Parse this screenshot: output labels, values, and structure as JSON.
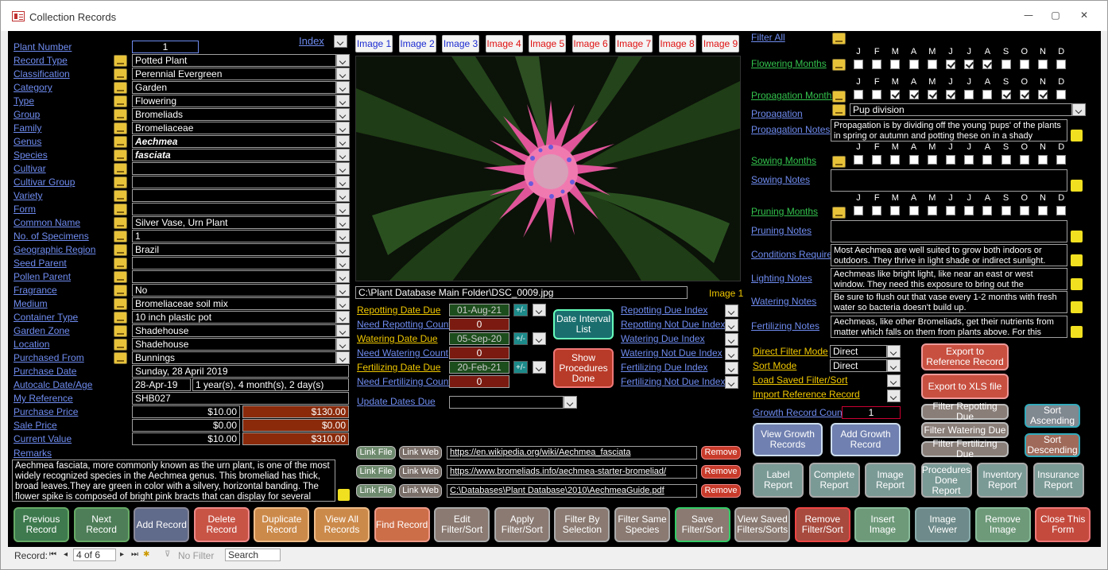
{
  "window": {
    "title": "Collection Records",
    "min": "—",
    "max": "▢",
    "close": "✕"
  },
  "left": {
    "index_label": "Index",
    "rows": [
      {
        "label": "Plant Number",
        "value": "1"
      },
      {
        "label": "Record Type",
        "value": "Potted Plant"
      },
      {
        "label": "Classification",
        "value": "Perennial Evergreen"
      },
      {
        "label": "Category",
        "value": "Garden"
      },
      {
        "label": "Type",
        "value": "Flowering"
      },
      {
        "label": "Group",
        "value": "Bromeliads"
      },
      {
        "label": "Family",
        "value": "Bromeliaceae"
      },
      {
        "label": "Genus",
        "value": "Aechmea"
      },
      {
        "label": "Species",
        "value": "fasciata"
      },
      {
        "label": "Cultivar",
        "value": ""
      },
      {
        "label": "Cultivar Group",
        "value": ""
      },
      {
        "label": "Variety",
        "value": ""
      },
      {
        "label": "Form",
        "value": ""
      },
      {
        "label": "Common Name",
        "value": "Silver Vase, Urn Plant"
      },
      {
        "label": "No. of Specimens",
        "value": "1"
      },
      {
        "label": "Geographic Region",
        "value": "Brazil"
      },
      {
        "label": "Seed Parent",
        "value": ""
      },
      {
        "label": "Pollen Parent",
        "value": ""
      },
      {
        "label": "Fragrance",
        "value": "No"
      },
      {
        "label": "Medium",
        "value": "Bromeliaceae soil mix"
      },
      {
        "label": "Container Type",
        "value": "10 inch plastic pot"
      },
      {
        "label": "Garden Zone",
        "value": "Shadehouse"
      },
      {
        "label": "Location",
        "value": "Shadehouse"
      },
      {
        "label": "Purchased From",
        "value": "Bunnings"
      }
    ],
    "purchase_date_label": "Purchase Date",
    "purchase_date": "Sunday, 28 April 2019",
    "autocalc_label": "Autocalc Date/Age",
    "autocalc_date": "28-Apr-19",
    "autocalc_age": "1 year(s), 4 month(s), 2 day(s)",
    "my_reference_label": "My Reference",
    "my_reference": "SHB027",
    "purchase_price_label": "Purchase Price",
    "purchase_price": "$10.00",
    "purchase_price_total": "$130.00",
    "sale_price_label": "Sale Price",
    "sale_price": "$0.00",
    "sale_price_total": "$0.00",
    "current_value_label": "Current Value",
    "current_value": "$10.00",
    "current_value_total": "$310.00",
    "remarks_label": "Remarks",
    "remarks": "Aechmea fasciata, more commonly known as the urn plant, is one of the most widely recognized species in the Aechmea genus. This bromeliad has thick, broad leaves.They are green in color with a silvery, horizontal banding. The flower spike is composed of bright pink bracts that can display for several"
  },
  "images": {
    "tabs": [
      "Image 1",
      "Image 2",
      "Image 3",
      "Image 4",
      "Image 5",
      "Image 6",
      "Image 7",
      "Image 8",
      "Image 9"
    ],
    "path": "C:\\Plant Database Main Folder\\DSC_0009.jpg",
    "current": "Image 1"
  },
  "dates": {
    "repotting_label": "Repotting Date Due",
    "repotting_date": "01-Aug-21",
    "need_repotting_label": "Need Repotting Count",
    "need_repotting": "0",
    "watering_label": "Watering Date Due",
    "watering_date": "05-Sep-20",
    "need_watering_label": "Need Watering Count",
    "need_watering": "0",
    "fertilizing_label": "Fertilizing Date Due",
    "fertilizing_date": "20-Feb-21",
    "need_fertilizing_label": "Need Fertilizing Count",
    "need_fertilizing": "0",
    "update_label": "Update Dates Due",
    "pm": "+/-",
    "date_interval_button": "Date Interval List",
    "show_procedures_button": "Show Procedures Done",
    "indexes": [
      "Repotting Due Index",
      "Repotting Not Due Index",
      "Watering Due Index",
      "Watering Not Due Index",
      "Fertilizing Due Index",
      "Fertilizing Not Due Index"
    ]
  },
  "links": {
    "link_file": "Link File",
    "link_web": "Link Web",
    "remove": "Remove",
    "urls": [
      "https://en.wikipedia.org/wiki/Aechmea_fasciata",
      "https://www.bromeliads.info/aechmea-starter-bromeliad/",
      "C:\\Databases\\Plant Database\\2010\\AechmeaGuide.pdf"
    ]
  },
  "right": {
    "filter_all": "Filter All",
    "months": [
      "J",
      "F",
      "M",
      "A",
      "M",
      "J",
      "J",
      "A",
      "S",
      "O",
      "N",
      "D"
    ],
    "flowering_label": "Flowering Months",
    "flowering": [
      false,
      false,
      false,
      false,
      false,
      true,
      true,
      true,
      false,
      false,
      false,
      false
    ],
    "propagation_months_label": "Propagation Months",
    "propagation": [
      false,
      false,
      true,
      true,
      true,
      true,
      false,
      false,
      true,
      true,
      true,
      false
    ],
    "propagation_label": "Propagation",
    "propagation_value": "Pup division",
    "propagation_notes_label": "Propagation Notes",
    "propagation_notes": "Propagation is by dividing off the young 'pups' of the plants in spring or autumn and potting these on in a shady",
    "sowing_label": "Sowing Months",
    "sowing": [
      false,
      false,
      false,
      false,
      false,
      false,
      false,
      false,
      false,
      false,
      false,
      false
    ],
    "sowing_notes_label": "Sowing Notes",
    "sowing_notes": "",
    "pruning_label": "Pruning Months",
    "pruning": [
      false,
      false,
      false,
      false,
      false,
      false,
      false,
      false,
      false,
      false,
      false,
      false
    ],
    "pruning_notes_label": "Pruning Notes",
    "pruning_notes": "",
    "conditions_label": "Conditions Required",
    "conditions": "Most Aechmea are well suited to grow both indoors or outdoors. They thrive in light shade or indirect sunlight.",
    "lighting_label": "Lighting Notes",
    "lighting": "Aechmeas like bright light, like near an east or west window. They need this exposure to bring out the",
    "watering_label": "Watering Notes",
    "watering": "Be sure to flush out that vase every 1-2 months with fresh water so bacteria doesn't build up.",
    "fertilizing_label": "Fertilizing Notes",
    "fertilizing": "Aechmeas, like other Bromeliads, get their nutrients from matter which falls on them from plants above. For this",
    "direct_filter_label": "Direct Filter Mode",
    "direct_filter": "Direct",
    "sort_mode_label": "Sort Mode",
    "sort_mode": "Direct",
    "load_saved_label": "Load Saved Filter/Sort",
    "import_ref_label": "Import Reference Record",
    "growth_count_label": "Growth Record Count",
    "growth_count": "1",
    "export_ref": "Export to Reference Record",
    "export_xls": "Export to XLS file",
    "view_growth": "View Growth Records",
    "add_growth": "Add Growth Record",
    "filter_repotting": "Filter Repotting Due",
    "filter_watering": "Filter Watering Due",
    "filter_fertilizing": "Filter Fertilizing Due",
    "sort_asc": "Sort Ascending",
    "sort_desc": "Sort Descending",
    "reports": [
      "Label Report",
      "Complete Report",
      "Image Report",
      "Procedures Done Report",
      "Inventory Report",
      "Insurance Report"
    ]
  },
  "bottom_buttons": [
    "Previous Record",
    "Next Record",
    "Add Record",
    "Delete Record",
    "Duplicate Record",
    "View All Records",
    "Find Record",
    "Edit Filter/Sort",
    "Apply Filter/Sort",
    "Filter By Selection",
    "Filter Same Species",
    "Save Filter/Sort",
    "View Saved Filters/Sorts",
    "Remove Filter/Sort",
    "Insert Image",
    "Image Viewer",
    "Remove Image",
    "Close This Form"
  ],
  "status": {
    "record_label": "Record:",
    "record_pos": "4 of 6",
    "no_filter": "No Filter",
    "search": "Search"
  }
}
